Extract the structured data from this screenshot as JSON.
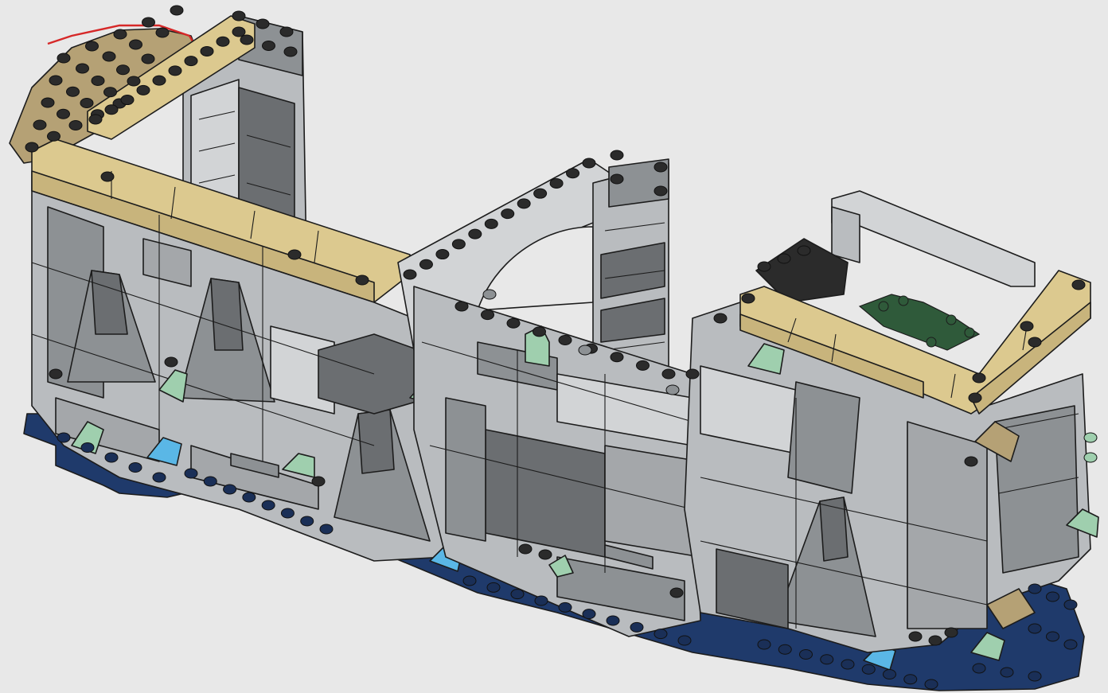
{
  "colors": {
    "background": "#e8e8e8",
    "light_gray": "#b9bcbf",
    "medium_gray": "#8d9194",
    "dark_gray": "#6b6e71",
    "pale_gray": "#d2d4d6",
    "tan": "#dcc98f",
    "dark_tan": "#b5a175",
    "dark_blue": "#1f3a6b",
    "trans_light_blue": "#5ab7e6",
    "sand_green": "#9fcfae",
    "dark_green": "#2f5a3a",
    "black": "#2b2b2b",
    "highlight_outline": "#d62828"
  },
  "scene": {
    "subject": "lego-castle-wall-build-step",
    "icons": [
      "highlighted-quarter-round-plate-icon",
      "stud-icon",
      "plant-piece-icon",
      "trans-light-blue-slope-icon"
    ]
  }
}
